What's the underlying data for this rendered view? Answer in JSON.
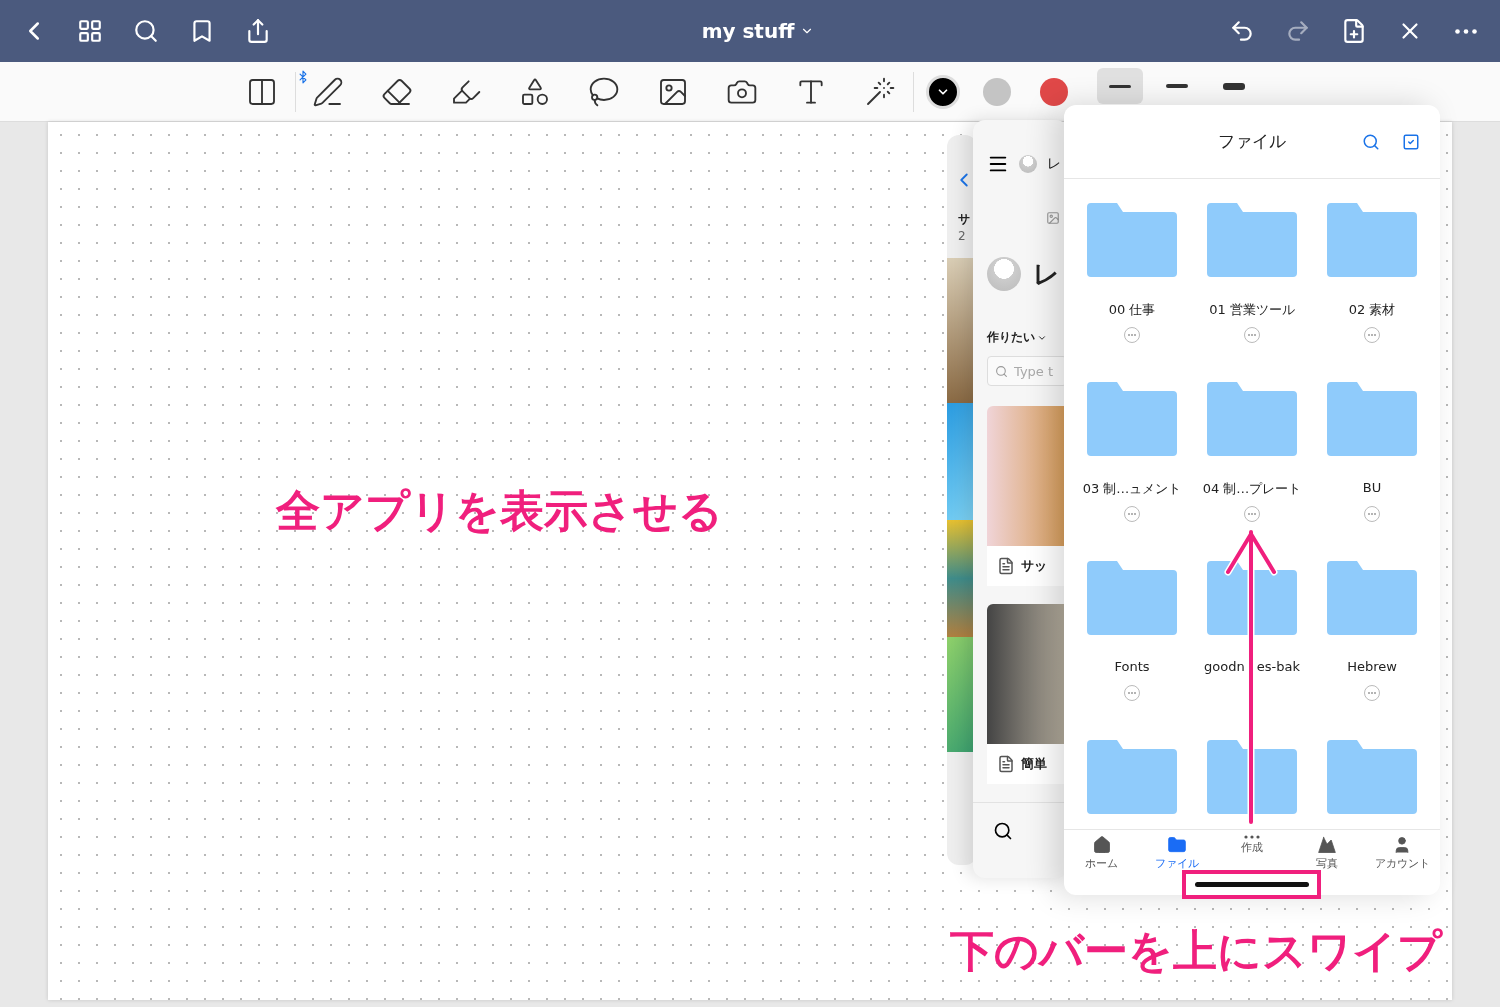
{
  "top_bar": {
    "title": "my stuff"
  },
  "toolbar": {
    "colors": [
      {
        "color": "#000000",
        "selected": true
      },
      {
        "color": "#c4c4c4",
        "selected": false
      },
      {
        "color": "#e04848",
        "selected": false
      }
    ],
    "widths": [
      {
        "selected": true
      },
      {
        "selected": false
      },
      {
        "selected": false
      }
    ]
  },
  "canvas": {
    "annotation": "全アプリを表示させる",
    "instruction": "下のバーを上にスワイプ"
  },
  "app_switcher": {
    "back_card": {
      "heading": "サ",
      "subheading": "2"
    },
    "middle_card": {
      "title": "レ",
      "heading": "レ",
      "filter": "作りたい",
      "search": {
        "placeholder": "Type t"
      },
      "recipes": [
        {
          "title": "サッ"
        },
        {
          "title": "簡単"
        }
      ]
    },
    "files_app": {
      "title": "ファイル",
      "folders": [
        {
          "name": "00 仕事",
          "more_button": true
        },
        {
          "name": "01 営業ツール",
          "more_button": true
        },
        {
          "name": "02 素材",
          "more_button": true
        },
        {
          "name": "03 制…ュメント",
          "more_button": true
        },
        {
          "name": "04 制…プレート",
          "more_button": true
        },
        {
          "name": "BU",
          "more_button": true
        },
        {
          "name": "Fonts",
          "more_button": true
        },
        {
          "name": "goodn es-bak",
          "more_button": false
        },
        {
          "name": "Hebrew",
          "more_button": true
        }
      ],
      "tabs": [
        {
          "label": "ホーム",
          "selected": false
        },
        {
          "label": "ファイル",
          "selected": true
        },
        {
          "label": "作成",
          "selected": false
        },
        {
          "label": "写真",
          "selected": false
        },
        {
          "label": "アカウント",
          "selected": false
        }
      ]
    }
  }
}
